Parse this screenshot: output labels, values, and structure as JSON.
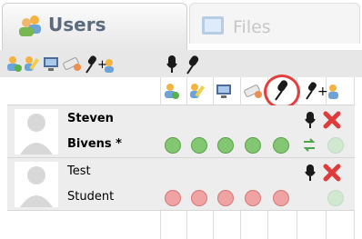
{
  "tabs": [
    {
      "label": "Users",
      "icon": "users-icon",
      "active": true
    },
    {
      "label": "Files",
      "icon": "files-icon",
      "active": false
    }
  ],
  "toolbar_icons": [
    "add-user-icon",
    "edit-user-icon",
    "monitor-icon",
    "erase-icon",
    "mic-plus-icon",
    "mic-icon",
    "mic-icon-dark"
  ],
  "header_icons": [
    "add-user-icon",
    "edit-user-icon",
    "monitor-icon",
    "erase-icon",
    "mic-icon",
    "mic-plus-icon"
  ],
  "users": [
    {
      "first": "Steven",
      "last": "Bivens *",
      "bold": true,
      "status": [
        "ok",
        "ok",
        "ok",
        "ok",
        "ok"
      ],
      "extra": "sync",
      "dot": "empty"
    },
    {
      "first": "Test",
      "last": "Student",
      "bold": false,
      "status": [
        "no",
        "no",
        "no",
        "no",
        "no"
      ],
      "extra": "",
      "dot": "empty"
    }
  ],
  "colors": {
    "ok": "#84c773",
    "no": "#f0a3a3",
    "highlight": "#e53c3c"
  }
}
